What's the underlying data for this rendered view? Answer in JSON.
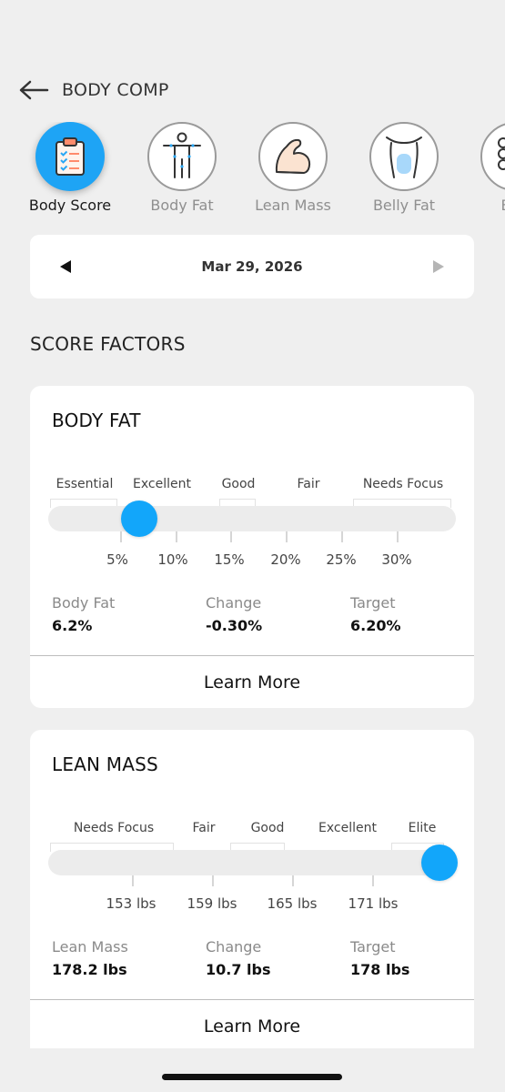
{
  "header": {
    "title": "BODY COMP"
  },
  "tabs": [
    {
      "label": "Body Score",
      "icon": "clipboard-checklist-icon"
    },
    {
      "label": "Body Fat",
      "icon": "body-outline-icon"
    },
    {
      "label": "Lean Mass",
      "icon": "flexed-arm-icon"
    },
    {
      "label": "Belly Fat",
      "icon": "torso-icon"
    },
    {
      "label": "Bon",
      "icon": "bone-icon"
    }
  ],
  "date_nav": {
    "date": "Mar 29, 2026"
  },
  "section_title": "SCORE FACTORS",
  "body_fat": {
    "title": "BODY FAT",
    "ranges": [
      "Essential",
      "Excellent",
      "Good",
      "Fair",
      "Needs Focus"
    ],
    "ticks": [
      "5%",
      "10%",
      "15%",
      "20%",
      "25%",
      "30%"
    ],
    "stats": [
      {
        "label": "Body Fat",
        "value": "6.2%"
      },
      {
        "label": "Change",
        "value": "-0.30%"
      },
      {
        "label": "Target",
        "value": "6.20%"
      }
    ],
    "learn_more": "Learn More"
  },
  "lean_mass": {
    "title": "LEAN MASS",
    "ranges": [
      "Needs Focus",
      "Fair",
      "Good",
      "Excellent",
      "Elite"
    ],
    "ticks": [
      "153 lbs",
      "159 lbs",
      "165 lbs",
      "171 lbs"
    ],
    "stats": [
      {
        "label": "Lean Mass",
        "value": "178.2 lbs"
      },
      {
        "label": "Change",
        "value": "10.7 lbs"
      },
      {
        "label": "Target",
        "value": "178 lbs"
      }
    ],
    "learn_more": "Learn More"
  },
  "colors": {
    "accent": "#12a6fa",
    "background": "#efefef",
    "card": "#ffffff"
  }
}
